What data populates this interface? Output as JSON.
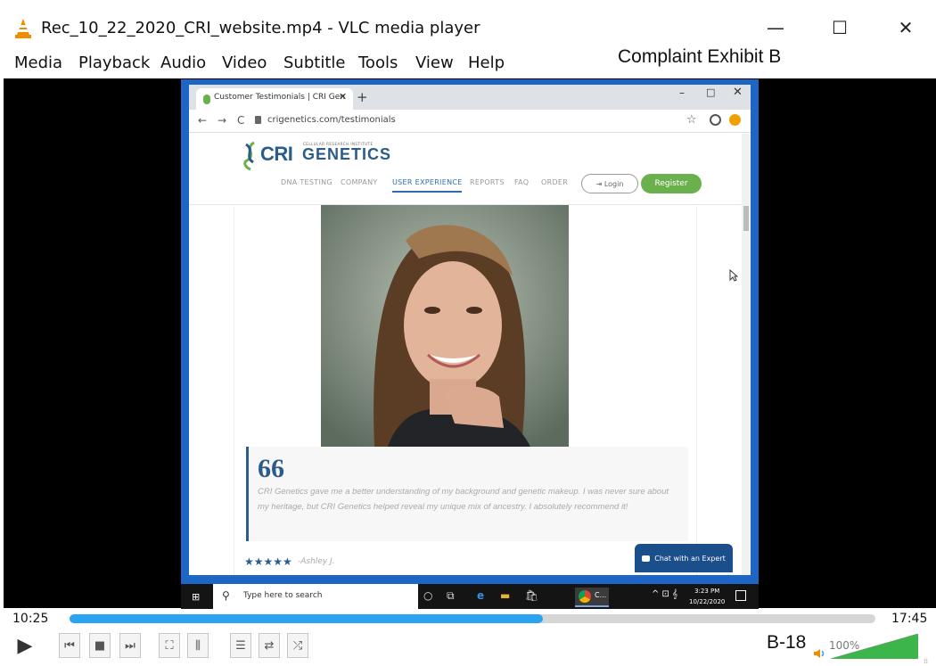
{
  "window": {
    "title": "Rec_10_22_2020_CRI_website.mp4 - VLC media player",
    "minimize": "—",
    "maximize": "☐",
    "close": "✕"
  },
  "menu": {
    "items": [
      "Media",
      "Playback",
      "Audio",
      "Video",
      "Subtitle",
      "Tools",
      "View",
      "Help"
    ]
  },
  "overlay": {
    "exhibit_label": "Complaint Exhibit B",
    "page_label": "B-18"
  },
  "browser": {
    "tab_title": "Customer Testimonials | CRI Gen",
    "tab_close": "✕",
    "new_tab": "+",
    "win_min": "–",
    "win_max": "□",
    "win_close": "✕",
    "back": "←",
    "forward": "→",
    "reload": "C",
    "url": "crigenetics.com/testimonials",
    "star": "☆"
  },
  "site": {
    "logo_cri": "CRI",
    "logo_genetics": "GENETICS",
    "logo_sub": "CELLULAR RESEARCH INSTITUTE",
    "nav": [
      "DNA TESTING",
      "COMPANY",
      "USER EXPERIENCE",
      "REPORTS",
      "FAQ",
      "ORDER"
    ],
    "active_nav": "USER EXPERIENCE",
    "login": "⇥ Login",
    "register": "Register",
    "quote_mark": "66",
    "testimonial": "CRI Genetics gave me a better understanding of my background and genetic makeup. I was never sure about my heritage, but CRI Genetics helped reveal my unique mix of ancestry. I absolutely recommend it!",
    "stars": "★★★★★",
    "reviewer": "-Ashley J.",
    "chat": "Chat with an Expert",
    "brand_blue": "#2b5c8a",
    "brand_green": "#6ab04c"
  },
  "taskbar": {
    "start": "⊞",
    "search_icon": "⚲",
    "search_placeholder": "Type here to search",
    "chrome_label": "C...",
    "tray": "^ ⊡ 𝄞",
    "time": "3:23 PM",
    "date": "10/22/2020"
  },
  "player": {
    "current_time": "10:25",
    "total_time": "17:45",
    "progress_fraction": 0.587,
    "volume_label": "100%",
    "volume_fraction": 1.0,
    "accent": "#2aa3f2",
    "volume_color": "#3cb54a"
  },
  "buttons": {
    "play": "▶",
    "prev": "⏮",
    "stop": "■",
    "next": "⏭",
    "fullscreen": "⛶",
    "equalizer": "⫼",
    "playlist": "☰",
    "loop": "⇄",
    "shuffle": "⤮"
  }
}
